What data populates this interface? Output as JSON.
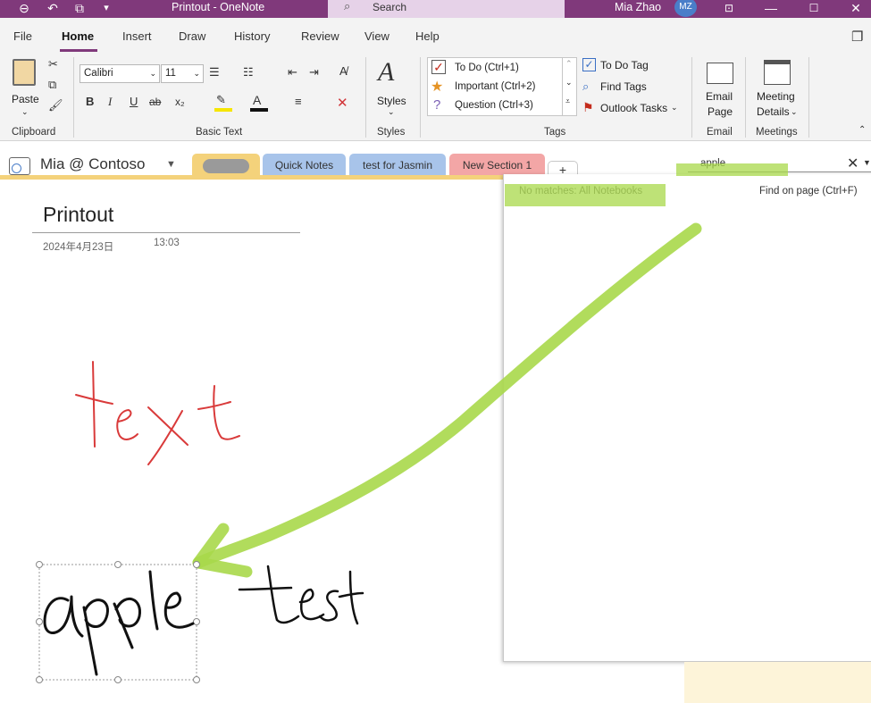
{
  "titlebar": {
    "title": "Printout  -  OneNote",
    "search_placeholder": "Search",
    "user_name": "Mia  Zhao",
    "avatar_initials": "MZ"
  },
  "ribbon_tabs": [
    "File",
    "Home",
    "Insert",
    "Draw",
    "History",
    "Review",
    "View",
    "Help"
  ],
  "ribbon": {
    "clipboard": {
      "paste": "Paste",
      "label": "Clipboard"
    },
    "basic_text": {
      "font": "Calibri",
      "size": "11",
      "label": "Basic Text",
      "bold": "B",
      "italic": "I",
      "underline": "U",
      "strike": "ab",
      "subscript": "x₂"
    },
    "styles": {
      "button": "Styles",
      "label": "Styles"
    },
    "tags": {
      "items": [
        "To Do (Ctrl+1)",
        "Important (Ctrl+2)",
        "Question (Ctrl+3)"
      ],
      "todo_tag": "To Do Tag",
      "find_tags": "Find Tags",
      "outlook_tasks": "Outlook Tasks",
      "label": "Tags"
    },
    "email": {
      "line1": "Email",
      "line2": "Page",
      "label": "Email"
    },
    "meetings": {
      "line1": "Meeting",
      "line2": "Details",
      "label": "Meetings"
    }
  },
  "notebook": {
    "name": "Mia @ Contoso",
    "sections": [
      "Quick Notes",
      "test for Jasmin",
      "New Section 1"
    ],
    "add_section": "+"
  },
  "page": {
    "title": "Printout",
    "date": "2024年4月23日",
    "time": "13:03"
  },
  "search": {
    "query": "apple",
    "no_matches": "No matches:  All Notebooks",
    "find_on_page": "Find on page (Ctrl+F)"
  },
  "ink": {
    "red_word": "text",
    "black_word_1": "apple",
    "black_word_2": "test"
  },
  "colors": {
    "titlebar": "#80397b",
    "highlight_green": "#a8d84a",
    "ink_red": "#d93a3a",
    "ink_black": "#111111",
    "section_yellow": "#f4d27b",
    "section_blue": "#a8c4ea",
    "section_red": "#f3a6a6"
  }
}
